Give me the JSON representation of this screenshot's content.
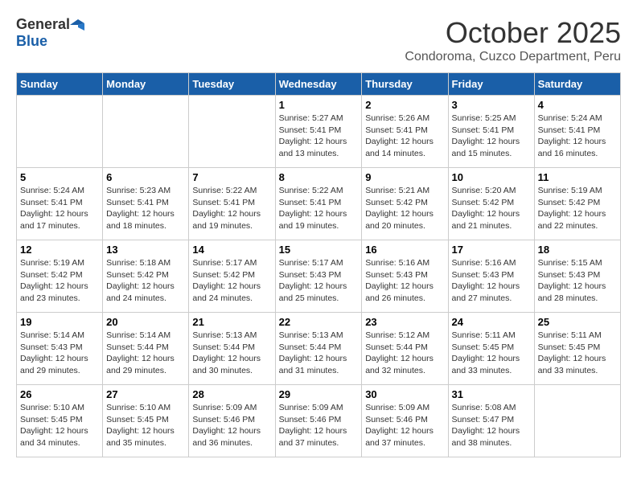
{
  "header": {
    "logo_general": "General",
    "logo_blue": "Blue",
    "month_title": "October 2025",
    "location": "Condoroma, Cuzco Department, Peru"
  },
  "weekdays": [
    "Sunday",
    "Monday",
    "Tuesday",
    "Wednesday",
    "Thursday",
    "Friday",
    "Saturday"
  ],
  "weeks": [
    [
      {
        "day": "",
        "info": ""
      },
      {
        "day": "",
        "info": ""
      },
      {
        "day": "",
        "info": ""
      },
      {
        "day": "1",
        "info": "Sunrise: 5:27 AM\nSunset: 5:41 PM\nDaylight: 12 hours\nand 13 minutes."
      },
      {
        "day": "2",
        "info": "Sunrise: 5:26 AM\nSunset: 5:41 PM\nDaylight: 12 hours\nand 14 minutes."
      },
      {
        "day": "3",
        "info": "Sunrise: 5:25 AM\nSunset: 5:41 PM\nDaylight: 12 hours\nand 15 minutes."
      },
      {
        "day": "4",
        "info": "Sunrise: 5:24 AM\nSunset: 5:41 PM\nDaylight: 12 hours\nand 16 minutes."
      }
    ],
    [
      {
        "day": "5",
        "info": "Sunrise: 5:24 AM\nSunset: 5:41 PM\nDaylight: 12 hours\nand 17 minutes."
      },
      {
        "day": "6",
        "info": "Sunrise: 5:23 AM\nSunset: 5:41 PM\nDaylight: 12 hours\nand 18 minutes."
      },
      {
        "day": "7",
        "info": "Sunrise: 5:22 AM\nSunset: 5:41 PM\nDaylight: 12 hours\nand 19 minutes."
      },
      {
        "day": "8",
        "info": "Sunrise: 5:22 AM\nSunset: 5:41 PM\nDaylight: 12 hours\nand 19 minutes."
      },
      {
        "day": "9",
        "info": "Sunrise: 5:21 AM\nSunset: 5:42 PM\nDaylight: 12 hours\nand 20 minutes."
      },
      {
        "day": "10",
        "info": "Sunrise: 5:20 AM\nSunset: 5:42 PM\nDaylight: 12 hours\nand 21 minutes."
      },
      {
        "day": "11",
        "info": "Sunrise: 5:19 AM\nSunset: 5:42 PM\nDaylight: 12 hours\nand 22 minutes."
      }
    ],
    [
      {
        "day": "12",
        "info": "Sunrise: 5:19 AM\nSunset: 5:42 PM\nDaylight: 12 hours\nand 23 minutes."
      },
      {
        "day": "13",
        "info": "Sunrise: 5:18 AM\nSunset: 5:42 PM\nDaylight: 12 hours\nand 24 minutes."
      },
      {
        "day": "14",
        "info": "Sunrise: 5:17 AM\nSunset: 5:42 PM\nDaylight: 12 hours\nand 24 minutes."
      },
      {
        "day": "15",
        "info": "Sunrise: 5:17 AM\nSunset: 5:43 PM\nDaylight: 12 hours\nand 25 minutes."
      },
      {
        "day": "16",
        "info": "Sunrise: 5:16 AM\nSunset: 5:43 PM\nDaylight: 12 hours\nand 26 minutes."
      },
      {
        "day": "17",
        "info": "Sunrise: 5:16 AM\nSunset: 5:43 PM\nDaylight: 12 hours\nand 27 minutes."
      },
      {
        "day": "18",
        "info": "Sunrise: 5:15 AM\nSunset: 5:43 PM\nDaylight: 12 hours\nand 28 minutes."
      }
    ],
    [
      {
        "day": "19",
        "info": "Sunrise: 5:14 AM\nSunset: 5:43 PM\nDaylight: 12 hours\nand 29 minutes."
      },
      {
        "day": "20",
        "info": "Sunrise: 5:14 AM\nSunset: 5:44 PM\nDaylight: 12 hours\nand 29 minutes."
      },
      {
        "day": "21",
        "info": "Sunrise: 5:13 AM\nSunset: 5:44 PM\nDaylight: 12 hours\nand 30 minutes."
      },
      {
        "day": "22",
        "info": "Sunrise: 5:13 AM\nSunset: 5:44 PM\nDaylight: 12 hours\nand 31 minutes."
      },
      {
        "day": "23",
        "info": "Sunrise: 5:12 AM\nSunset: 5:44 PM\nDaylight: 12 hours\nand 32 minutes."
      },
      {
        "day": "24",
        "info": "Sunrise: 5:11 AM\nSunset: 5:45 PM\nDaylight: 12 hours\nand 33 minutes."
      },
      {
        "day": "25",
        "info": "Sunrise: 5:11 AM\nSunset: 5:45 PM\nDaylight: 12 hours\nand 33 minutes."
      }
    ],
    [
      {
        "day": "26",
        "info": "Sunrise: 5:10 AM\nSunset: 5:45 PM\nDaylight: 12 hours\nand 34 minutes."
      },
      {
        "day": "27",
        "info": "Sunrise: 5:10 AM\nSunset: 5:45 PM\nDaylight: 12 hours\nand 35 minutes."
      },
      {
        "day": "28",
        "info": "Sunrise: 5:09 AM\nSunset: 5:46 PM\nDaylight: 12 hours\nand 36 minutes."
      },
      {
        "day": "29",
        "info": "Sunrise: 5:09 AM\nSunset: 5:46 PM\nDaylight: 12 hours\nand 37 minutes."
      },
      {
        "day": "30",
        "info": "Sunrise: 5:09 AM\nSunset: 5:46 PM\nDaylight: 12 hours\nand 37 minutes."
      },
      {
        "day": "31",
        "info": "Sunrise: 5:08 AM\nSunset: 5:47 PM\nDaylight: 12 hours\nand 38 minutes."
      },
      {
        "day": "",
        "info": ""
      }
    ]
  ]
}
